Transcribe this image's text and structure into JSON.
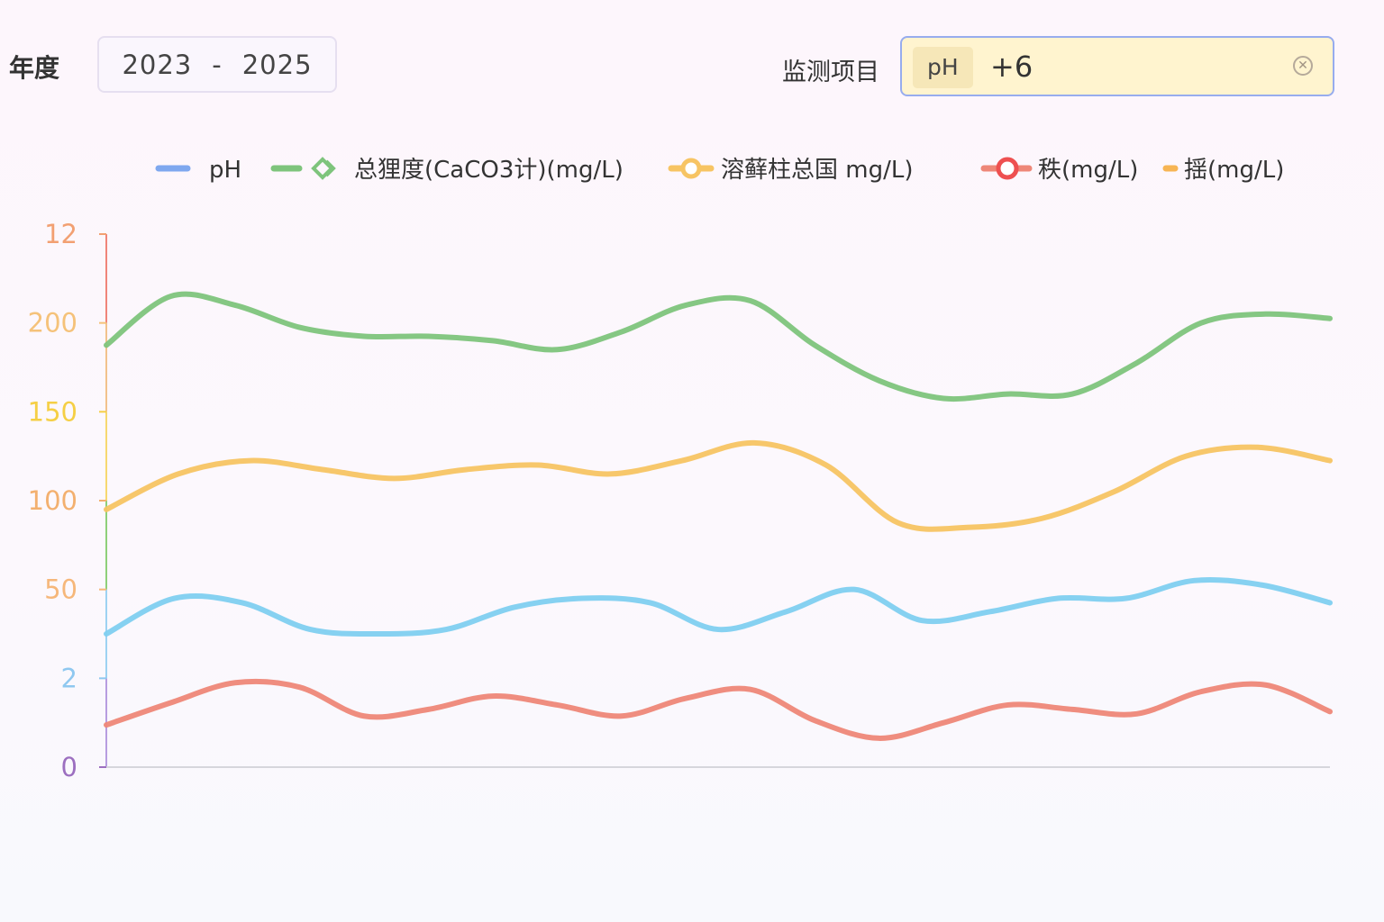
{
  "filters": {
    "year_label": "年度",
    "year_start": "2023",
    "year_separator": "-",
    "year_end": "2025",
    "item_label": "监测项目",
    "selected_tag": "pH",
    "more_tags": "+6"
  },
  "chart_data": {
    "type": "line",
    "legend_position": "top",
    "grid": false,
    "y_ticks": [
      {
        "label": "0",
        "color": "#9c6fc0"
      },
      {
        "label": "2",
        "color": "#8fc8f0"
      },
      {
        "label": "50",
        "color": "#f6b77a"
      },
      {
        "label": "100",
        "color": "#f3b06f"
      },
      {
        "label": "150",
        "color": "#f5cf45"
      },
      {
        "label": "200",
        "color": "#f5c27a"
      },
      {
        "label": "12",
        "color": "#f2a072"
      }
    ],
    "axis_segment_colors": [
      "#b79de0",
      "#9dd2f2",
      "#8fd07a",
      "#f7d870",
      "#f2c28c",
      "#f0857a"
    ],
    "ylim": [
      0,
      12
    ],
    "series": [
      {
        "name": "pH",
        "color": "#7fa8ef",
        "legend_symbol": "line",
        "values": []
      },
      {
        "name": "总狸度(CaCO3计)(mg/L)",
        "color": "#7ec47c",
        "legend_symbol": "diamond",
        "values": [
          9.5,
          10.6,
          10.4,
          9.9,
          9.7,
          9.7,
          9.6,
          9.4,
          9.8,
          10.4,
          10.5,
          9.5,
          8.7,
          8.3,
          8.4,
          8.4,
          9.1,
          10.0,
          10.2,
          10.1
        ]
      },
      {
        "name": "溶藓柱总国 mg/L)",
        "color": "#f7c463",
        "legend_symbol": "circle",
        "values": [
          5.8,
          6.6,
          6.9,
          6.7,
          6.5,
          6.7,
          6.8,
          6.6,
          6.9,
          7.3,
          6.8,
          5.5,
          5.4,
          5.6,
          6.2,
          7.0,
          7.2,
          6.9
        ]
      },
      {
        "name": "",
        "color": "#7fcff0",
        "legend_symbol": "none",
        "values": [
          3.0,
          3.8,
          3.7,
          3.1,
          3.0,
          3.1,
          3.6,
          3.8,
          3.7,
          3.1,
          3.5,
          4.0,
          3.3,
          3.5,
          3.8,
          3.8,
          4.2,
          4.1,
          3.7
        ]
      },
      {
        "name": "秩(mg/L)",
        "color": "#ee8778",
        "legend_symbol": "ring",
        "values": [
          0.95,
          1.45,
          1.9,
          1.8,
          1.15,
          1.3,
          1.6,
          1.4,
          1.15,
          1.55,
          1.75,
          1.05,
          0.65,
          1.0,
          1.4,
          1.3,
          1.2,
          1.7,
          1.85,
          1.25
        ]
      },
      {
        "name": "揺(mg/L)",
        "color": "#f7b554",
        "legend_symbol": "dot",
        "values": []
      }
    ]
  }
}
